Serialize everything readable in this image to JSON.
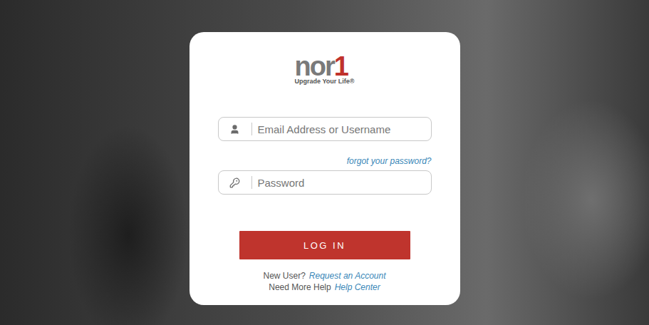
{
  "logo": {
    "text": "nor",
    "accent": "1",
    "tagline": "Upgrade Your Life®"
  },
  "fields": [
    {
      "name": "email",
      "placeholder": "Email Address or Username",
      "type": "text",
      "icon": "user"
    },
    {
      "name": "password",
      "placeholder": "Password",
      "type": "password",
      "icon": "key"
    }
  ],
  "forgot_link": "forgot your password?",
  "login_button": "LOG IN",
  "footer": [
    {
      "prompt": "New User?",
      "link": "Request an Account"
    },
    {
      "prompt": "Need More Help",
      "link": "Help Center"
    }
  ]
}
